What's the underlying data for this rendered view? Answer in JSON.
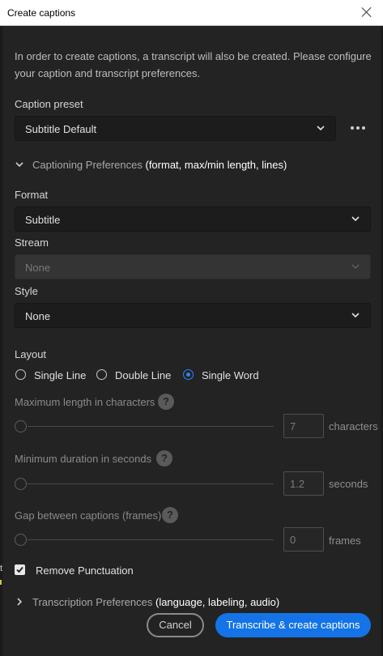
{
  "window": {
    "title": "Create captions"
  },
  "intro_text": "In order to create captions, a transcript will also be created. Please configure your caption and transcript preferences.",
  "caption_preset": {
    "label": "Caption preset",
    "value": "Subtitle Default",
    "more_icon": "more-horizontal-icon"
  },
  "captioning_prefs": {
    "title": "Captioning Preferences",
    "hint": "(format, max/min length, lines)",
    "expanded": true,
    "format": {
      "label": "Format",
      "value": "Subtitle"
    },
    "stream": {
      "label": "Stream",
      "value": "None",
      "disabled": true
    },
    "style": {
      "label": "Style",
      "value": "None"
    },
    "layout": {
      "label": "Layout",
      "options": [
        "Single Line",
        "Double Line",
        "Single Word"
      ],
      "selected": "Single Word"
    },
    "max_length": {
      "label": "Maximum length in characters",
      "value": "7",
      "unit": "characters"
    },
    "min_duration": {
      "label": "Minimum duration in seconds",
      "value": "1.2",
      "unit": "seconds"
    },
    "gap": {
      "label": "Gap between captions (frames)",
      "value": "0",
      "unit": "frames"
    },
    "remove_punctuation": {
      "label": "Remove Punctuation",
      "checked": true
    }
  },
  "transcription_prefs": {
    "title": "Transcription Preferences",
    "hint": "(language, labeling, audio)",
    "expanded": false
  },
  "buttons": {
    "cancel": "Cancel",
    "primary": "Transcribe & create captions"
  },
  "edge_mark": "t",
  "colors": {
    "accent": "#1473e6",
    "radio_selected": "#2d84ff",
    "background": "#232323"
  }
}
